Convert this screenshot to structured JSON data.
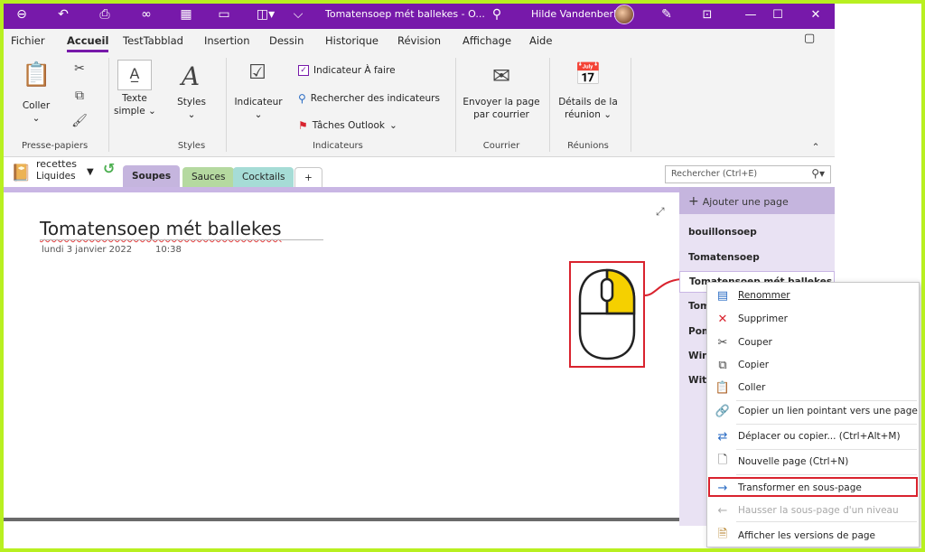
{
  "titlebar": {
    "title": "Tomatensoep mét ballekes - O...",
    "user": "Hilde Vandenberk",
    "icons": [
      "back-icon",
      "undo-icon",
      "print-icon",
      "link-icon",
      "table-icon",
      "open-icon",
      "insert-icon",
      "more-icon",
      "search-icon",
      "pen-icon",
      "restore-icon",
      "minimize-icon",
      "maximize-icon",
      "close-icon"
    ]
  },
  "menu": {
    "tabs": [
      "Fichier",
      "Accueil",
      "TestTabblad",
      "Insertion",
      "Dessin",
      "Historique",
      "Révision",
      "Affichage",
      "Aide"
    ],
    "active": "Accueil"
  },
  "ribbon": {
    "coller": "Coller",
    "texte": "Texte",
    "simple": "simple",
    "styles": "Styles",
    "indicateur": "Indicateur",
    "indicateur_faire": "Indicateur À faire",
    "rechercher_indicateurs": "Rechercher des indicateurs",
    "taches_outlook": "Tâches Outlook",
    "envoyer_1": "Envoyer la page",
    "envoyer_2": "par courrier",
    "details_1": "Détails de la",
    "details_2": "réunion",
    "groups": {
      "presse_papiers": "Presse-papiers",
      "styles": "Styles",
      "indicateurs": "Indicateurs",
      "courrier": "Courrier",
      "reunions": "Réunions"
    }
  },
  "notebook": {
    "name_top": "recettes",
    "name_bottom": "Liquides",
    "sections": [
      "Soupes",
      "Sauces",
      "Cocktails",
      "+"
    ],
    "section_colors": [
      "#c5b5de",
      "#b5d9a0",
      "#a6dcd6",
      "#ffffff"
    ],
    "search_placeholder": "Rechercher (Ctrl+E)"
  },
  "page": {
    "title": "Tomatensoep mét ballekes",
    "date": "lundi 3 janvier 2022",
    "time": "10:38"
  },
  "pagelist": {
    "add_page": "Ajouter une page",
    "pages": [
      "bouillonsoep",
      "Tomatensoep",
      "Tomatensoep mét ballekes",
      "Tom",
      "Pom",
      "Win",
      "Witl"
    ]
  },
  "context_menu": {
    "items": [
      {
        "label": "Renommer",
        "icon": "rename-icon",
        "disabled": false
      },
      {
        "label": "Supprimer",
        "icon": "delete-icon",
        "disabled": false
      },
      {
        "label": "Couper",
        "icon": "cut-icon",
        "disabled": false
      },
      {
        "label": "Copier",
        "icon": "copy-icon",
        "disabled": false
      },
      {
        "label": "Coller",
        "icon": "paste-icon",
        "disabled": false
      },
      {
        "label": "Copier un lien pointant vers une page",
        "icon": "link-page-icon",
        "disabled": false
      },
      {
        "label": "Déplacer ou copier...  (Ctrl+Alt+M)",
        "icon": "move-icon",
        "disabled": false
      },
      {
        "label": "Nouvelle page  (Ctrl+N)",
        "icon": "new-page-icon",
        "disabled": false
      },
      {
        "label": "Transformer en sous-page",
        "icon": "arrow-right-icon",
        "disabled": false
      },
      {
        "label": "Hausser la sous-page d'un niveau",
        "icon": "arrow-left-icon",
        "disabled": true
      },
      {
        "label": "Afficher les versions de page",
        "icon": "versions-icon",
        "disabled": false
      }
    ]
  },
  "colors": {
    "accent": "#7719aa",
    "highlight": "#d9232e",
    "mouse_button": "#f5d000",
    "frame": "#b8f020"
  }
}
